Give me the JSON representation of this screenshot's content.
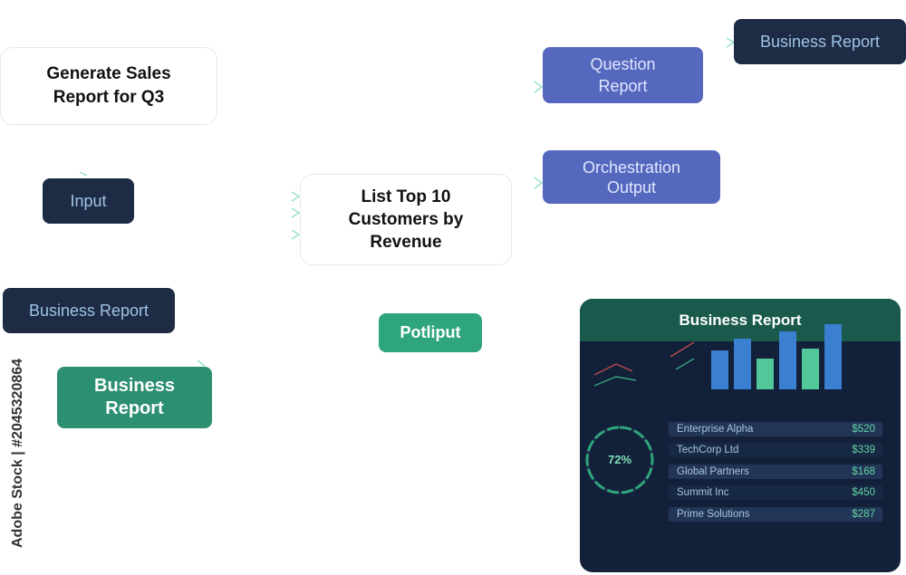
{
  "nodes": {
    "generate": "Generate Sales Report for Q3",
    "input": "Input",
    "list_top": "List Top 10 Customers by Revenue",
    "question": "Question Report",
    "orchestration": "Orchestration Output",
    "business_top": "Business Report",
    "business_left": "Business Report",
    "business_green": "Business Report",
    "potliput": "Potliput"
  },
  "dashboard": {
    "title": "Business Report",
    "ring_percent_label": "72%",
    "ring_percent": 72,
    "rows": [
      {
        "name": "Enterprise Alpha",
        "amount": "$520"
      },
      {
        "name": "TechCorp Ltd",
        "amount": "$339"
      },
      {
        "name": "Global Partners",
        "amount": "$168"
      },
      {
        "name": "Summit Inc",
        "amount": "$450"
      },
      {
        "name": "Prime Solutions",
        "amount": "$287"
      }
    ]
  },
  "chart_data": {
    "type": "bar",
    "categories": [
      "",
      "",
      "",
      "",
      "",
      ""
    ],
    "values": [
      43,
      56,
      34,
      64,
      45,
      72
    ],
    "title": "",
    "xlabel": "",
    "ylabel": "",
    "ylim": [
      0,
      80
    ],
    "grid": false
  },
  "credit": "Adobe Stock | #2045320864",
  "colors": {
    "bar_blue": "#3b7fd1",
    "bar_green": "#52c79a",
    "ring": "#2ea57b",
    "header_green": "#1a5a4c",
    "navy": "#1d2b45",
    "purple_blue": "#5668bd"
  }
}
